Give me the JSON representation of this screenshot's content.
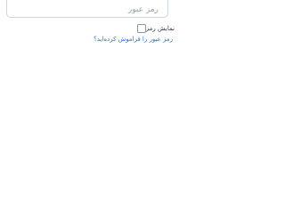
{
  "password_field": {
    "placeholder": "رمز عبور"
  },
  "show_password": {
    "label": "نمایش رمز",
    "checked": false
  },
  "forgot_password": {
    "label": "رمز عبور را فراموش کرده‌اید؟"
  },
  "colors": {
    "link": "#2f6fd6",
    "border": "#cfd6dc",
    "text": "#333a40"
  }
}
